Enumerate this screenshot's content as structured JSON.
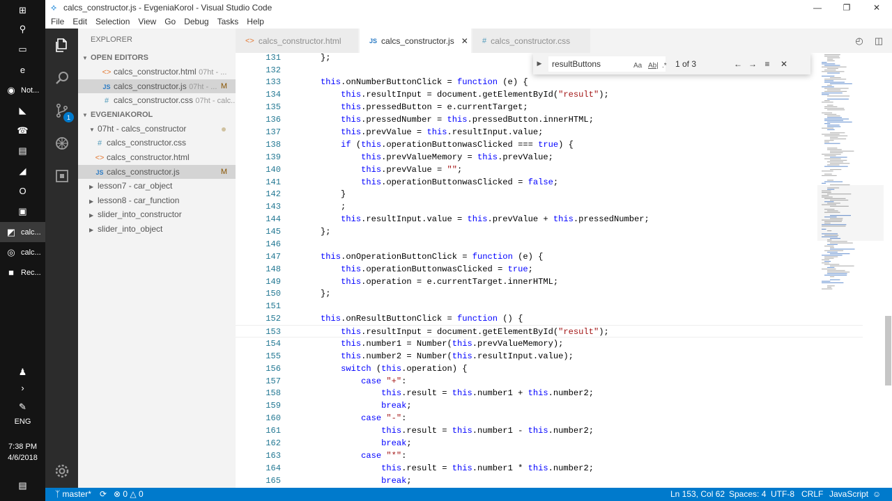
{
  "window": {
    "title": "calcs_constructor.js - EvgeniaKorol - Visual Studio Code"
  },
  "taskbar": {
    "items": [
      {
        "icon": "windows-start-icon",
        "label": ""
      },
      {
        "icon": "search-icon",
        "label": ""
      },
      {
        "icon": "task-view-icon",
        "label": ""
      },
      {
        "icon": "edge-icon",
        "label": ""
      },
      {
        "icon": "app-icon",
        "label": "Not..."
      },
      {
        "icon": "vs-icon",
        "label": ""
      },
      {
        "icon": "viber-icon",
        "label": ""
      },
      {
        "icon": "folder-icon",
        "label": ""
      },
      {
        "icon": "visual-studio-icon",
        "label": ""
      },
      {
        "icon": "opera-icon",
        "label": ""
      },
      {
        "icon": "app2-icon",
        "label": ""
      },
      {
        "icon": "vscode-icon",
        "label": "calc..."
      },
      {
        "icon": "chrome-icon",
        "label": "calc..."
      },
      {
        "icon": "recorder-icon",
        "label": "Rec..."
      }
    ],
    "lang": "ENG",
    "time": "7:38 PM",
    "date": "4/6/2018"
  },
  "menu": [
    "File",
    "Edit",
    "Selection",
    "View",
    "Go",
    "Debug",
    "Tasks",
    "Help"
  ],
  "sidebar": {
    "header": "EXPLORER",
    "open_editors_title": "OPEN EDITORS",
    "open_editors": [
      {
        "icon": "html",
        "name": "calcs_constructor.html",
        "detail": "07ht - ...",
        "mod": ""
      },
      {
        "icon": "js",
        "name": "calcs_constructor.js",
        "detail": "07ht - ...",
        "mod": "M"
      },
      {
        "icon": "css",
        "name": "calcs_constructor.css",
        "detail": "07ht - calc...",
        "mod": ""
      }
    ],
    "workspace_title": "EVGENIAKOROL",
    "tree": [
      {
        "indent": 1,
        "kind": "folder-open",
        "name": "07ht - calcs_constructor",
        "mod": "dot"
      },
      {
        "indent": 2,
        "kind": "css",
        "name": "calcs_constructor.css",
        "mod": ""
      },
      {
        "indent": 2,
        "kind": "html",
        "name": "calcs_constructor.html",
        "mod": ""
      },
      {
        "indent": 2,
        "kind": "js",
        "name": "calcs_constructor.js",
        "mod": "M"
      },
      {
        "indent": 1,
        "kind": "folder",
        "name": "lesson7 - car_object",
        "mod": ""
      },
      {
        "indent": 1,
        "kind": "folder",
        "name": "lesson8 - car_function",
        "mod": ""
      },
      {
        "indent": 1,
        "kind": "folder",
        "name": "slider_into_constructor",
        "mod": ""
      },
      {
        "indent": 1,
        "kind": "folder",
        "name": "slider_into_object",
        "mod": ""
      }
    ]
  },
  "tabs": [
    {
      "icon": "html",
      "label": "calcs_constructor.html",
      "active": false
    },
    {
      "icon": "js",
      "label": "calcs_constructor.js",
      "active": true
    },
    {
      "icon": "css",
      "label": "calcs_constructor.css",
      "active": false
    }
  ],
  "find": {
    "query": "resultButtons",
    "count": "1 of 3",
    "opt_case": "Aa",
    "opt_word": "Ab|",
    "opt_regex": ".*"
  },
  "code": [
    {
      "n": "131",
      "t": "    };"
    },
    {
      "n": "132",
      "t": ""
    },
    {
      "n": "133",
      "t": "    this.onNumberButtonClick = function (e) {"
    },
    {
      "n": "134",
      "t": "        this.resultInput = document.getElementById(\"result\");"
    },
    {
      "n": "135",
      "t": "        this.pressedButton = e.currentTarget;"
    },
    {
      "n": "136",
      "t": "        this.pressedNumber = this.pressedButton.innerHTML;"
    },
    {
      "n": "137",
      "t": "        this.prevValue = this.resultInput.value;"
    },
    {
      "n": "138",
      "t": "        if (this.operationButtonwasClicked === true) {"
    },
    {
      "n": "139",
      "t": "            this.prevValueMemory = this.prevValue;"
    },
    {
      "n": "140",
      "t": "            this.prevValue = \"\";"
    },
    {
      "n": "141",
      "t": "            this.operationButtonwasClicked = false;"
    },
    {
      "n": "142",
      "t": "        }"
    },
    {
      "n": "143",
      "t": "        ;"
    },
    {
      "n": "144",
      "t": "        this.resultInput.value = this.prevValue + this.pressedNumber;"
    },
    {
      "n": "145",
      "t": "    };"
    },
    {
      "n": "146",
      "t": ""
    },
    {
      "n": "147",
      "t": "    this.onOperationButtonClick = function (e) {"
    },
    {
      "n": "148",
      "t": "        this.operationButtonwasClicked = true;"
    },
    {
      "n": "149",
      "t": "        this.operation = e.currentTarget.innerHTML;"
    },
    {
      "n": "150",
      "t": "    };"
    },
    {
      "n": "151",
      "t": ""
    },
    {
      "n": "152",
      "t": "    this.onResultButtonClick = function () {"
    },
    {
      "n": "153",
      "t": "        this.resultInput = document.getElementById(\"result\");"
    },
    {
      "n": "154",
      "t": "        this.number1 = Number(this.prevValueMemory);"
    },
    {
      "n": "155",
      "t": "        this.number2 = Number(this.resultInput.value);"
    },
    {
      "n": "156",
      "t": "        switch (this.operation) {"
    },
    {
      "n": "157",
      "t": "            case \"+\":"
    },
    {
      "n": "158",
      "t": "                this.result = this.number1 + this.number2;"
    },
    {
      "n": "159",
      "t": "                break;"
    },
    {
      "n": "160",
      "t": "            case \"-\":"
    },
    {
      "n": "161",
      "t": "                this.result = this.number1 - this.number2;"
    },
    {
      "n": "162",
      "t": "                break;"
    },
    {
      "n": "163",
      "t": "            case \"*\":"
    },
    {
      "n": "164",
      "t": "                this.result = this.number1 * this.number2;"
    },
    {
      "n": "165",
      "t": "                break;"
    }
  ],
  "current_line": "153",
  "status": {
    "branch": "master*",
    "errors": "0",
    "warnings": "0",
    "position": "Ln 153, Col 62",
    "spaces": "Spaces: 4",
    "encoding": "UTF-8",
    "eol": "CRLF",
    "language": "JavaScript"
  },
  "colors": {
    "accent": "#007acc",
    "keyword": "#0000ff",
    "string": "#a31515",
    "line_number": "#237893"
  }
}
